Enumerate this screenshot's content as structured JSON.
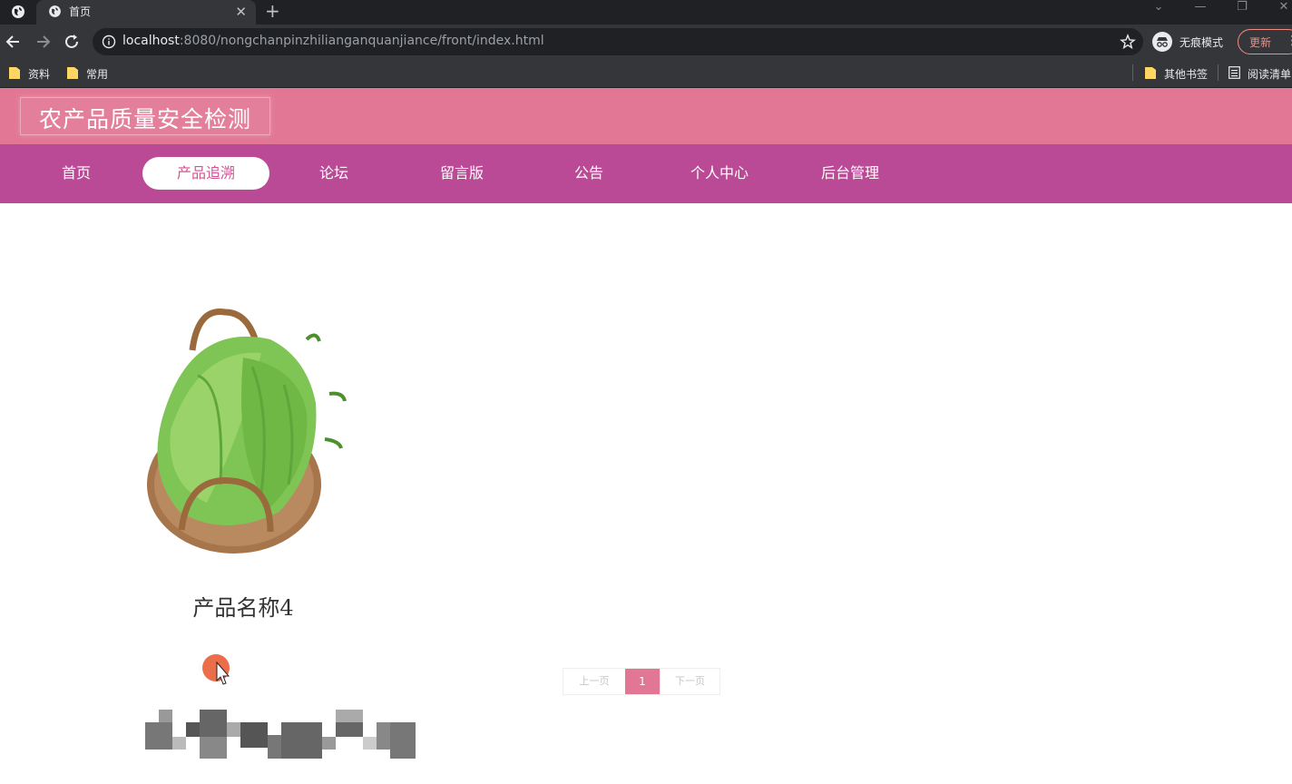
{
  "browser": {
    "tab": {
      "title": "首页"
    },
    "url": {
      "host": "localhost",
      "rest": ":8080/nongchanpinzhilianganquanjiance/front/index.html"
    },
    "incognito_label": "无痕模式",
    "update_label": "更新",
    "bookmarks": {
      "left": [
        "资料",
        "常用"
      ],
      "right": [
        "其他书签",
        "阅读清单"
      ]
    }
  },
  "site": {
    "title": "农产品质量安全检测",
    "nav": [
      {
        "label": "首页"
      },
      {
        "label": "产品追溯"
      },
      {
        "label": "论坛"
      },
      {
        "label": "留言版"
      },
      {
        "label": "公告"
      },
      {
        "label": "个人中心"
      },
      {
        "label": "后台管理"
      }
    ],
    "active_nav": "产品追溯"
  },
  "products": [
    {
      "name": "产品名称4",
      "image": "bitter-melon-basket"
    }
  ],
  "pagination": {
    "prev": "上一页",
    "current": "1",
    "next": "下一页"
  },
  "colors": {
    "header": "#e27795",
    "nav": "#bb4a96",
    "accent": "#d55393"
  }
}
